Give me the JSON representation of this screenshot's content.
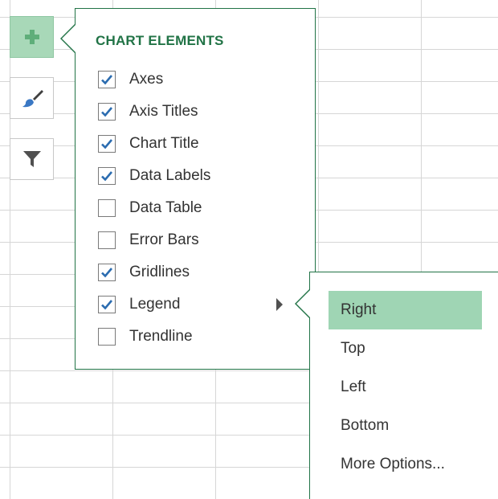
{
  "side_buttons": [
    {
      "name": "chart-elements-button",
      "icon": "plus-icon",
      "active": true
    },
    {
      "name": "chart-styles-button",
      "icon": "paintbrush-icon",
      "active": false
    },
    {
      "name": "chart-filters-button",
      "icon": "filter-icon",
      "active": false
    }
  ],
  "chart_elements": {
    "title": "CHART ELEMENTS",
    "items": [
      {
        "label": "Axes",
        "checked": true
      },
      {
        "label": "Axis Titles",
        "checked": true
      },
      {
        "label": "Chart Title",
        "checked": true
      },
      {
        "label": "Data Labels",
        "checked": true
      },
      {
        "label": "Data Table",
        "checked": false
      },
      {
        "label": "Error Bars",
        "checked": false
      },
      {
        "label": "Gridlines",
        "checked": true
      },
      {
        "label": "Legend",
        "checked": true,
        "has_submenu": true
      },
      {
        "label": "Trendline",
        "checked": false
      }
    ]
  },
  "legend_submenu": {
    "items": [
      {
        "label": "Right",
        "selected": true
      },
      {
        "label": "Top",
        "selected": false
      },
      {
        "label": "Left",
        "selected": false
      },
      {
        "label": "Bottom",
        "selected": false
      },
      {
        "label": "More Options...",
        "selected": false
      }
    ]
  },
  "colors": {
    "accent": "#217346",
    "active_button": "#a8d8b8",
    "selected_item": "#9fd5b4",
    "checkmark": "#2b6cb0"
  }
}
